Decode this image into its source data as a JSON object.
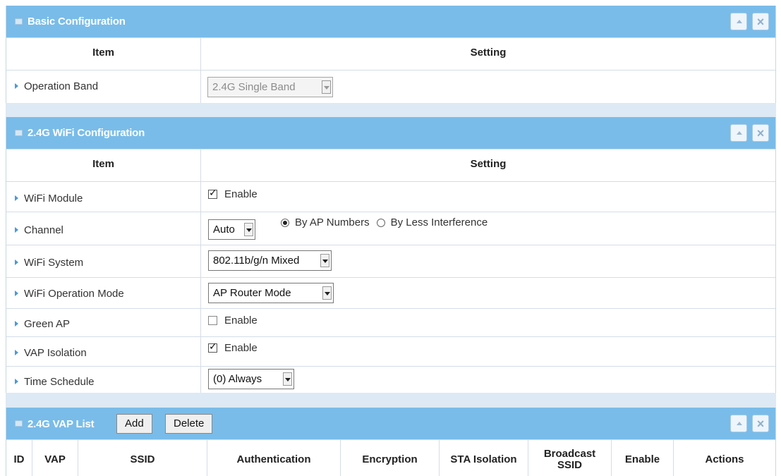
{
  "basic": {
    "title": "Basic Configuration",
    "col_item": "Item",
    "col_setting": "Setting",
    "operation_band": {
      "label": "Operation Band",
      "value": "2.4G Single Band"
    }
  },
  "wifi": {
    "title": "2.4G WiFi Configuration",
    "col_item": "Item",
    "col_setting": "Setting",
    "module": {
      "label": "WiFi Module",
      "option": "Enable",
      "checked": true
    },
    "channel": {
      "label": "Channel",
      "value": "Auto",
      "radio_ap": "By AP Numbers",
      "radio_interference": "By Less Interference",
      "selected": "By AP Numbers"
    },
    "system": {
      "label": "WiFi System",
      "value": "802.11b/g/n Mixed"
    },
    "op_mode": {
      "label": "WiFi Operation Mode",
      "value": "AP Router Mode"
    },
    "green_ap": {
      "label": "Green AP",
      "option": "Enable",
      "checked": false
    },
    "vap_isolation": {
      "label": "VAP Isolation",
      "option": "Enable",
      "checked": true
    },
    "time_schedule": {
      "label": "Time Schedule",
      "value": "(0) Always"
    }
  },
  "vap": {
    "title": "2.4G VAP List",
    "add_label": "Add",
    "delete_label": "Delete",
    "columns": {
      "id": "ID",
      "vap": "VAP",
      "ssid": "SSID",
      "auth": "Authentication",
      "enc": "Encryption",
      "sta": "STA Isolation",
      "broadcast_1": "Broadcast",
      "broadcast_2": "SSID",
      "enable": "Enable",
      "actions": "Actions"
    }
  },
  "colors": {
    "header_bg": "#79bce9",
    "gap_bg": "#dde9f4",
    "bullet": "#4a9ad6"
  }
}
